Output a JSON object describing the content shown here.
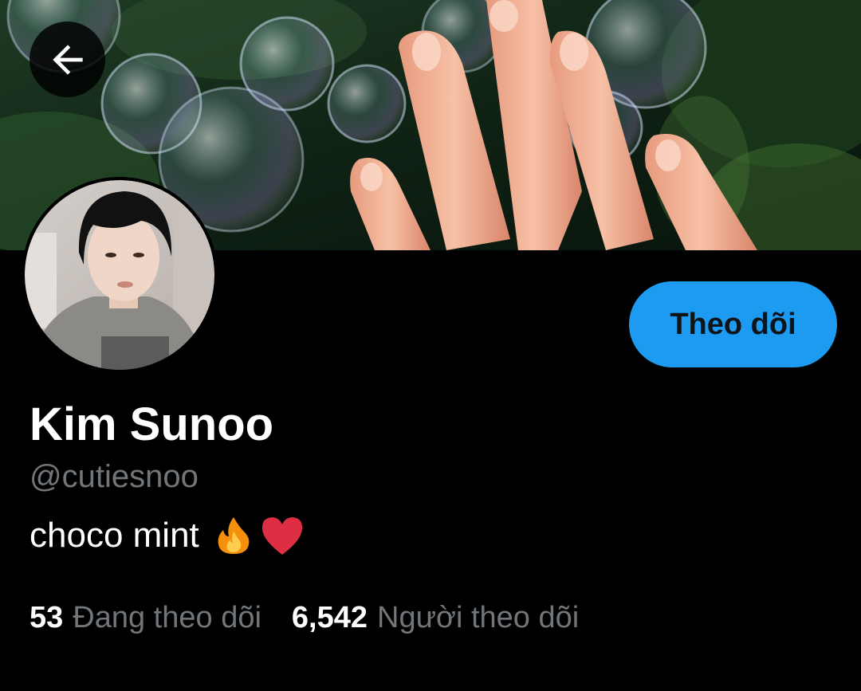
{
  "header": {
    "back_icon": "arrow-left-icon",
    "banner_image": "bubbles-and-hand-photo"
  },
  "profile": {
    "avatar_image": "profile-photo",
    "name": "Kim Sunoo",
    "handle": "@cutiesnoo",
    "bio_text": "choco mint",
    "bio_emoji": [
      "fire-emoji",
      "red-heart-emoji"
    ],
    "follow_label": "Theo dõi"
  },
  "stats": {
    "following_count": "53",
    "following_label": "Đang theo dõi",
    "followers_count": "6,542",
    "followers_label": "Người theo dõi"
  },
  "colors": {
    "background": "#000000",
    "accent": "#1d9bf0",
    "secondary_text": "#71767b",
    "primary_text": "#ffffff"
  }
}
